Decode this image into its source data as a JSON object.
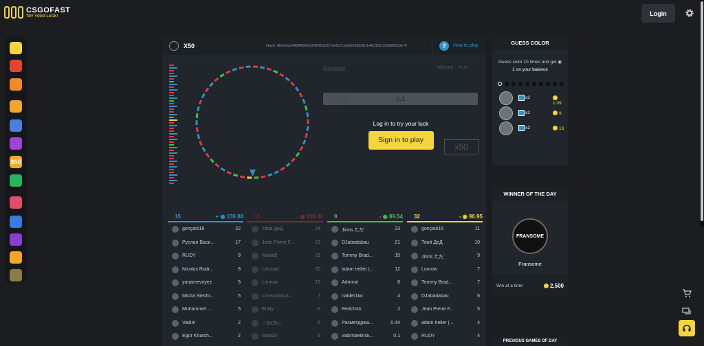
{
  "brand": {
    "name": "CSGOFAST",
    "tagline": "TRY YOUR LUCK!"
  },
  "header": {
    "login_label": "Login",
    "settings_icon": "gear-icon"
  },
  "sidebar": [
    {
      "icon": "crown-icon",
      "color": "#f5d53b"
    },
    {
      "icon": "fast-icon",
      "color": "#e4452f"
    },
    {
      "icon": "crossed-swords-icon",
      "color": "#f08a24"
    },
    {
      "icon": "double-icon",
      "color": "#f5a623"
    },
    {
      "icon": "x50-icon",
      "color": "#4a7fe0"
    },
    {
      "icon": "hilo-icon",
      "color": "#a044d6"
    },
    {
      "icon": "slot-icon",
      "color": "#f5a623",
      "text": "$50"
    },
    {
      "icon": "pie-icon",
      "color": "#27b45f"
    },
    {
      "icon": "poker-icon",
      "color": "#e54c6c"
    },
    {
      "icon": "tower-icon",
      "color": "#3a7de0"
    },
    {
      "icon": "tv-icon",
      "color": "#8a3fd3"
    },
    {
      "icon": "cases-icon",
      "color": "#f5a623"
    },
    {
      "icon": "star-icon",
      "color": "#8b7b48"
    }
  ],
  "game": {
    "mode": "X50",
    "hash_label": "Hash:",
    "hash": "0b9edad44284585fa146361922 6e5c7ceb66058b9b1b4031fb1339d8f53de74",
    "how_to_play": "How to play",
    "balance_label": "Balance",
    "tab_manual": "Manual",
    "tab_auto": "Auto",
    "bet_input_value": "0.1",
    "big_button": "x50",
    "overlay_message": "Log in to try your luck",
    "sign_in_label": "Sign in to play",
    "colors": {
      "blue": "#2f93c8",
      "red": "#e1374b",
      "green": "#3fc24a",
      "yellow": "#f5d53b"
    }
  },
  "columns": [
    {
      "color": "#2f93c8",
      "count": "15",
      "total": "+ ◉ 159.88",
      "dim": false,
      "rows": [
        {
          "name": "gonçalo16",
          "bet": "22"
        },
        {
          "name": "Руслан Васи...",
          "bet": "17"
        },
        {
          "name": "RUDY",
          "bet": "8"
        },
        {
          "name": "Nicolas Rodr...",
          "bet": "8"
        },
        {
          "name": "youamevoyez",
          "bet": "5"
        },
        {
          "name": "Misha Stechi...",
          "bet": "5"
        },
        {
          "name": "Muhammet ...",
          "bet": "5"
        },
        {
          "name": "Vadim",
          "bet": "2"
        },
        {
          "name": "Egor Kharch...",
          "bet": "2"
        }
      ]
    },
    {
      "color": "#e1374b",
      "count": "15",
      "total": "- ◉ 156.38",
      "dim": true,
      "rows": [
        {
          "name": "Твой ДеД",
          "bet": "24"
        },
        {
          "name": "Jean Pierre F...",
          "bet": "23"
        },
        {
          "name": "Nabat5",
          "bet": "21"
        },
        {
          "name": "Letsooo",
          "bet": "20"
        },
        {
          "name": "Lonrow",
          "bet": "15"
        },
        {
          "name": "Lorenzoho A...",
          "bet": "7"
        },
        {
          "name": "Emily",
          "bet": "6"
        },
        {
          "name": "☆SKTe☆",
          "bet": "6"
        },
        {
          "name": "nishi33",
          "bet": "5"
        }
      ]
    },
    {
      "color": "#3fc24a",
      "count": "9",
      "total": "- ◉ 89.54",
      "dim": false,
      "rows": [
        {
          "name": "Jinns ただ",
          "bet": "23"
        },
        {
          "name": "DJabadabau",
          "bet": "21"
        },
        {
          "name": "Tommy Brad...",
          "bet": "15"
        },
        {
          "name": "adam heller (...",
          "bet": "12"
        },
        {
          "name": "Admiral",
          "bet": "8"
        },
        {
          "name": "nalder1ko",
          "bet": "4"
        },
        {
          "name": "Redchick",
          "bet": "2"
        },
        {
          "name": "Рахметдржа...",
          "bet": "0.44"
        },
        {
          "name": "vadimbelinsk...",
          "bet": "0.1"
        }
      ]
    },
    {
      "color": "#f5d53b",
      "count": "32",
      "total": "- ◉ 90.95",
      "dim": false,
      "rows": [
        {
          "name": "gonçalo16",
          "bet": "11"
        },
        {
          "name": "Твой ДеД",
          "bet": "10"
        },
        {
          "name": "Jinns ただ",
          "bet": "9"
        },
        {
          "name": "Lonrow",
          "bet": "7"
        },
        {
          "name": "Tommy Brad...",
          "bet": "7"
        },
        {
          "name": "DJabadabau",
          "bet": "6"
        },
        {
          "name": "Jean Pierre F...",
          "bet": "5"
        },
        {
          "name": "adam heller (...",
          "bet": "4"
        },
        {
          "name": "RUDY",
          "bet": "4"
        }
      ]
    }
  ],
  "guess": {
    "title": "GUESS COLOR",
    "line1": "Guess color 10 times and get ◉",
    "line2": "1 on your balance",
    "dot_count": 10,
    "rows": [
      {
        "mult": "x2",
        "amount": "1.09"
      },
      {
        "mult": "x2",
        "amount": "9"
      },
      {
        "mult": "x2",
        "amount": "18"
      }
    ]
  },
  "winner": {
    "title": "WINNER OF THE DAY",
    "badge_text": "FRANSOME",
    "name": "Fransome",
    "win_label": "Win at a time:",
    "win_value": "2,500"
  },
  "next_title": "PREVIOUS GAMES OF DAY",
  "floats": [
    "cart-icon",
    "chat-icon",
    "support-icon"
  ]
}
